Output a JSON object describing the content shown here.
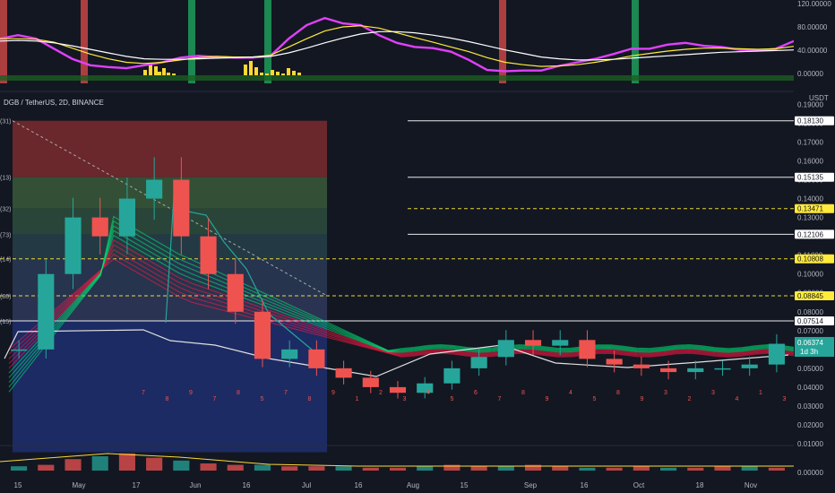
{
  "header": {
    "symbol": "DGB / TetherUS, 2D, BINANCE"
  },
  "price_axis": {
    "unit": "USDT",
    "ticks": [
      "0.19000",
      "0.18000",
      "0.17000",
      "0.16000",
      "0.15000",
      "0.14000",
      "0.13000",
      "0.12000",
      "0.11000",
      "0.10000",
      "0.09000",
      "0.08000",
      "0.07000",
      "0.06000",
      "0.05000",
      "0.04000",
      "0.03000",
      "0.02000",
      "0.01000"
    ]
  },
  "osc_axis": {
    "ticks": [
      "120.00000",
      "80.00000",
      "40.00000",
      "0.00000"
    ]
  },
  "vol_axis": {
    "ticks": [
      "0.00000"
    ]
  },
  "time_axis": {
    "ticks": [
      "15",
      "May",
      "17",
      "Jun",
      "16",
      "Jul",
      "16",
      "Aug",
      "15",
      "Sep",
      "16",
      "Oct",
      "18",
      "Nov"
    ]
  },
  "fib_side_labels": [
    "(31)",
    "(13)",
    "(32)",
    "(73)",
    "(14)",
    "(80)",
    "(15)"
  ],
  "candle_counts": [
    "7",
    "8",
    "9",
    "7",
    "8",
    "5",
    "7",
    "8",
    "9",
    "1",
    "2",
    "3",
    "4",
    "5",
    "6",
    "7",
    "8",
    "9",
    "4",
    "5",
    "8",
    "9",
    "3",
    "2",
    "3",
    "4",
    "1",
    "3"
  ],
  "level_labels": [
    {
      "text": "0.18130",
      "color": "#ffffff"
    },
    {
      "text": "0.15135",
      "color": "#ffffff"
    },
    {
      "text": "0.13471",
      "color": "#ffeb3b"
    },
    {
      "text": "0.12106",
      "color": "#ffffff"
    },
    {
      "text": "0.10808",
      "color": "#ffeb3b"
    },
    {
      "text": "0.08845",
      "color": "#ffeb3b"
    },
    {
      "text": "0.07514",
      "color": "#ffffff"
    }
  ],
  "last_price": {
    "price": "0.06374",
    "countdown": "1d 3h",
    "color": "#26a69a"
  },
  "colors": {
    "bg": "#131722",
    "up": "#26a69a",
    "down": "#ef5350",
    "ribbon_up": "#00e676",
    "ribbon_down": "#ff1744",
    "osc_fast": "#e040fb",
    "osc_signal": "#ffeb3b",
    "osc_slow": "#ffffff"
  },
  "chart_data": [
    {
      "type": "line",
      "title": "",
      "ylim": [
        0,
        120
      ],
      "series": [
        {
          "values": [
            62,
            68,
            62,
            45,
            28,
            17,
            14,
            12,
            17,
            22,
            30,
            33,
            31,
            30,
            30,
            33,
            62,
            85,
            97,
            88,
            85,
            68,
            55,
            48,
            46,
            40,
            26,
            9,
            7,
            8,
            8,
            16,
            22,
            28,
            36,
            45,
            45,
            52,
            55,
            50,
            48,
            43,
            42,
            45,
            58
          ]
        },
        {
          "values": [
            62,
            62,
            61,
            56,
            46,
            36,
            28,
            22,
            20,
            22,
            26,
            30,
            32,
            31,
            31,
            34,
            48,
            62,
            75,
            82,
            84,
            80,
            72,
            64,
            56,
            48,
            40,
            30,
            22,
            18,
            15,
            16,
            18,
            22,
            27,
            33,
            37,
            41,
            44,
            46,
            46,
            45,
            44,
            45,
            49
          ]
        },
        {
          "values": [
            58,
            59,
            58,
            55,
            50,
            44,
            38,
            32,
            28,
            27,
            27,
            28,
            29,
            30,
            31,
            32,
            38,
            46,
            55,
            63,
            70,
            74,
            74,
            72,
            68,
            63,
            57,
            50,
            43,
            37,
            31,
            28,
            26,
            26,
            27,
            29,
            31,
            33,
            35,
            37,
            39,
            40,
            41,
            42,
            43
          ]
        }
      ]
    },
    {
      "type": "bar",
      "ylim": [
        0,
        0.19
      ],
      "series": [
        {
          "name": "DGB / TetherUS",
          "values": [
            0.06,
            0.1,
            0.13,
            0.12,
            0.14,
            0.15,
            0.12,
            0.1,
            0.08,
            0.055,
            0.06,
            0.05,
            0.045,
            0.04,
            0.037,
            0.042,
            0.05,
            0.056,
            0.065,
            0.062,
            0.065,
            0.055,
            0.052,
            0.05,
            0.048,
            0.05,
            0.05,
            0.052,
            0.063
          ]
        }
      ],
      "levels": [
        0.1813,
        0.15135,
        0.13471,
        0.12106,
        0.10808,
        0.08845,
        0.07514
      ]
    },
    {
      "type": "bar",
      "values": [
        3,
        4,
        8,
        10,
        12,
        9,
        7,
        5,
        4,
        4,
        3,
        3,
        3,
        2,
        2,
        3,
        4,
        3,
        3,
        4,
        3,
        2,
        2,
        3,
        2,
        2,
        3,
        3,
        2
      ]
    }
  ]
}
